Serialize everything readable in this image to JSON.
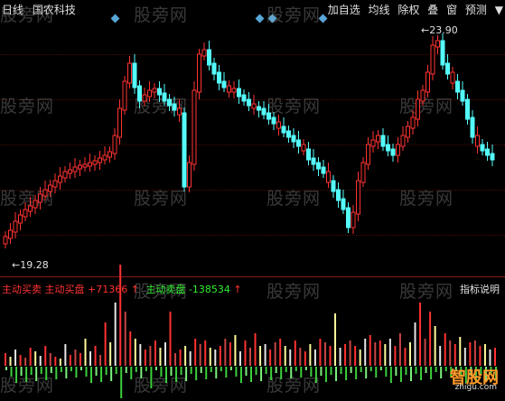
{
  "topbar": {
    "period": "日线",
    "stock_name": "国农科技"
  },
  "toolbar": {
    "items": [
      "加自选",
      "均线",
      "除权",
      "叠",
      "窗",
      "预测",
      "▼"
    ]
  },
  "price": {
    "high_label": "23.90",
    "low_label": "19.28"
  },
  "indicator": {
    "name": "主动买卖",
    "buy_label": "主动买盘",
    "buy_value": "+71366",
    "sell_label": "主动卖盘",
    "sell_value": "-138534",
    "arrow": "↑",
    "help": "指标说明"
  },
  "watermark": "股旁网",
  "logo": {
    "name": "智股网",
    "url": "zhigu.com"
  },
  "colors": {
    "up": "#ff3232",
    "down": "#54fcfc",
    "grid": "#8a1a1a",
    "watermark": "#8c8c8c"
  }
}
